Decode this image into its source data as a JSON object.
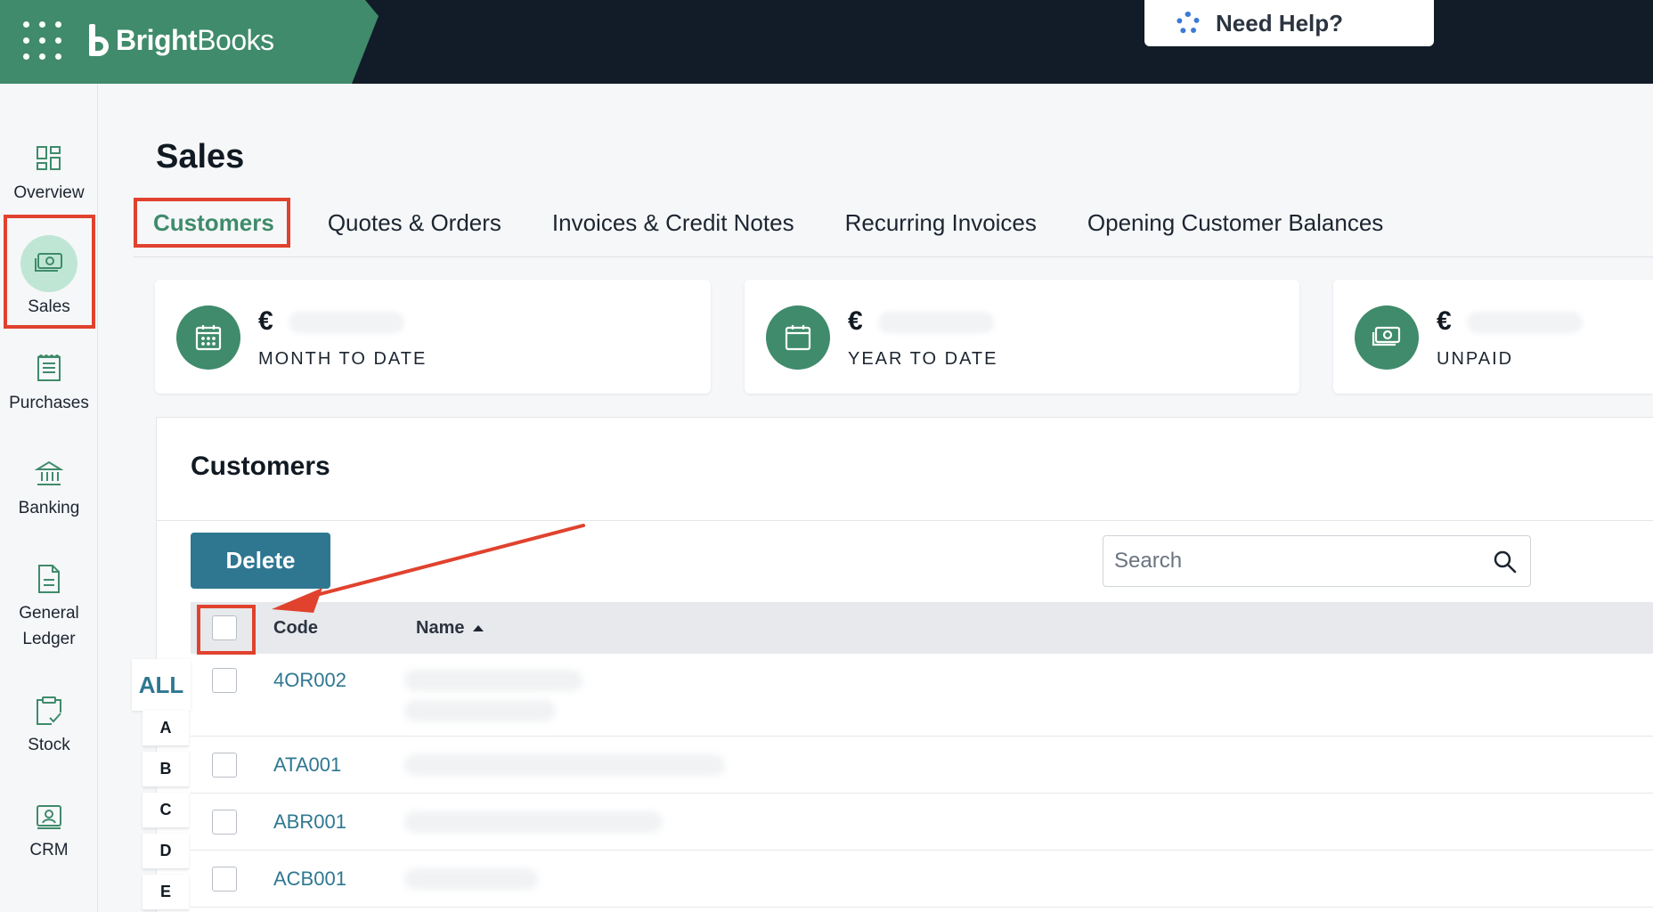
{
  "app": {
    "brand_bold": "Bright",
    "brand_light": "Books",
    "help_label": "Need Help?"
  },
  "sidebar": {
    "items": [
      {
        "label": "Overview",
        "icon": "grid-icon"
      },
      {
        "label": "Sales",
        "icon": "cash-icon",
        "active": true
      },
      {
        "label": "Purchases",
        "icon": "receipt-icon"
      },
      {
        "label": "Banking",
        "icon": "bank-icon"
      },
      {
        "label": "General\nLedger",
        "label_line1": "General",
        "label_line2": "Ledger",
        "icon": "document-icon"
      },
      {
        "label": "Stock",
        "icon": "clipboard-check-icon"
      },
      {
        "label": "CRM",
        "icon": "contact-card-icon"
      }
    ]
  },
  "page": {
    "title": "Sales",
    "tabs": [
      {
        "label": "Customers",
        "active": true
      },
      {
        "label": "Quotes & Orders"
      },
      {
        "label": "Invoices & Credit Notes"
      },
      {
        "label": "Recurring Invoices"
      },
      {
        "label": "Opening Customer Balances"
      }
    ]
  },
  "kpis": [
    {
      "currency": "€",
      "label": "MONTH TO DATE",
      "icon": "calendar-grid-icon"
    },
    {
      "currency": "€",
      "label": "YEAR TO DATE",
      "icon": "calendar-icon"
    },
    {
      "currency": "€",
      "label": "UNPAID",
      "icon": "cash-icon"
    }
  ],
  "customers": {
    "title": "Customers",
    "delete_label": "Delete",
    "search_placeholder": "Search",
    "columns": {
      "code": "Code",
      "name": "Name"
    },
    "sort": {
      "column": "Name",
      "direction": "ascending"
    },
    "rows": [
      {
        "code": "4OR002"
      },
      {
        "code": "ATA001"
      },
      {
        "code": "ABR001"
      },
      {
        "code": "ACB001"
      }
    ]
  },
  "alphabet": {
    "all": "ALL",
    "letters": [
      "A",
      "B",
      "C",
      "D",
      "E"
    ]
  },
  "annotation_color": "#e0422e",
  "brand_color": "#3f8b6b",
  "link_color": "#2f7791"
}
